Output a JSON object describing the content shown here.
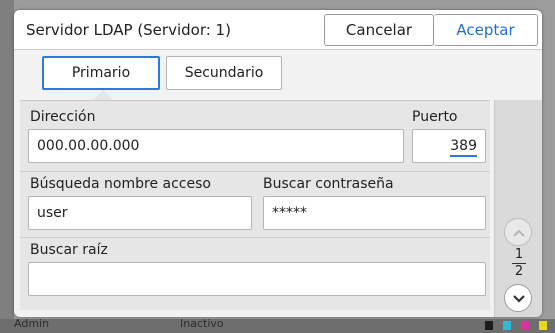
{
  "background": {
    "status_user": "Admin",
    "status_state": "Inactivo"
  },
  "dialog": {
    "title": "Servidor LDAP (Servidor: 1)",
    "cancel_label": "Cancelar",
    "accept_label": "Aceptar",
    "accent_color": "#1f6fd1"
  },
  "tabs": [
    {
      "label": "Primario",
      "selected": true
    },
    {
      "label": "Secundario",
      "selected": false
    }
  ],
  "form": {
    "address_label": "Dirección",
    "address_value": "000.00.00.000",
    "port_label": "Puerto",
    "port_value": "389",
    "login_search_label": "Búsqueda nombre acceso",
    "login_search_value": "user",
    "password_search_label": "Buscar contraseña",
    "password_search_value": "*****",
    "root_search_label": "Buscar raíz",
    "root_search_value": ""
  },
  "pager": {
    "current": "1",
    "total": "2"
  },
  "icons": {
    "scroll_up": "chevron-up-icon",
    "scroll_down": "chevron-down-icon"
  }
}
